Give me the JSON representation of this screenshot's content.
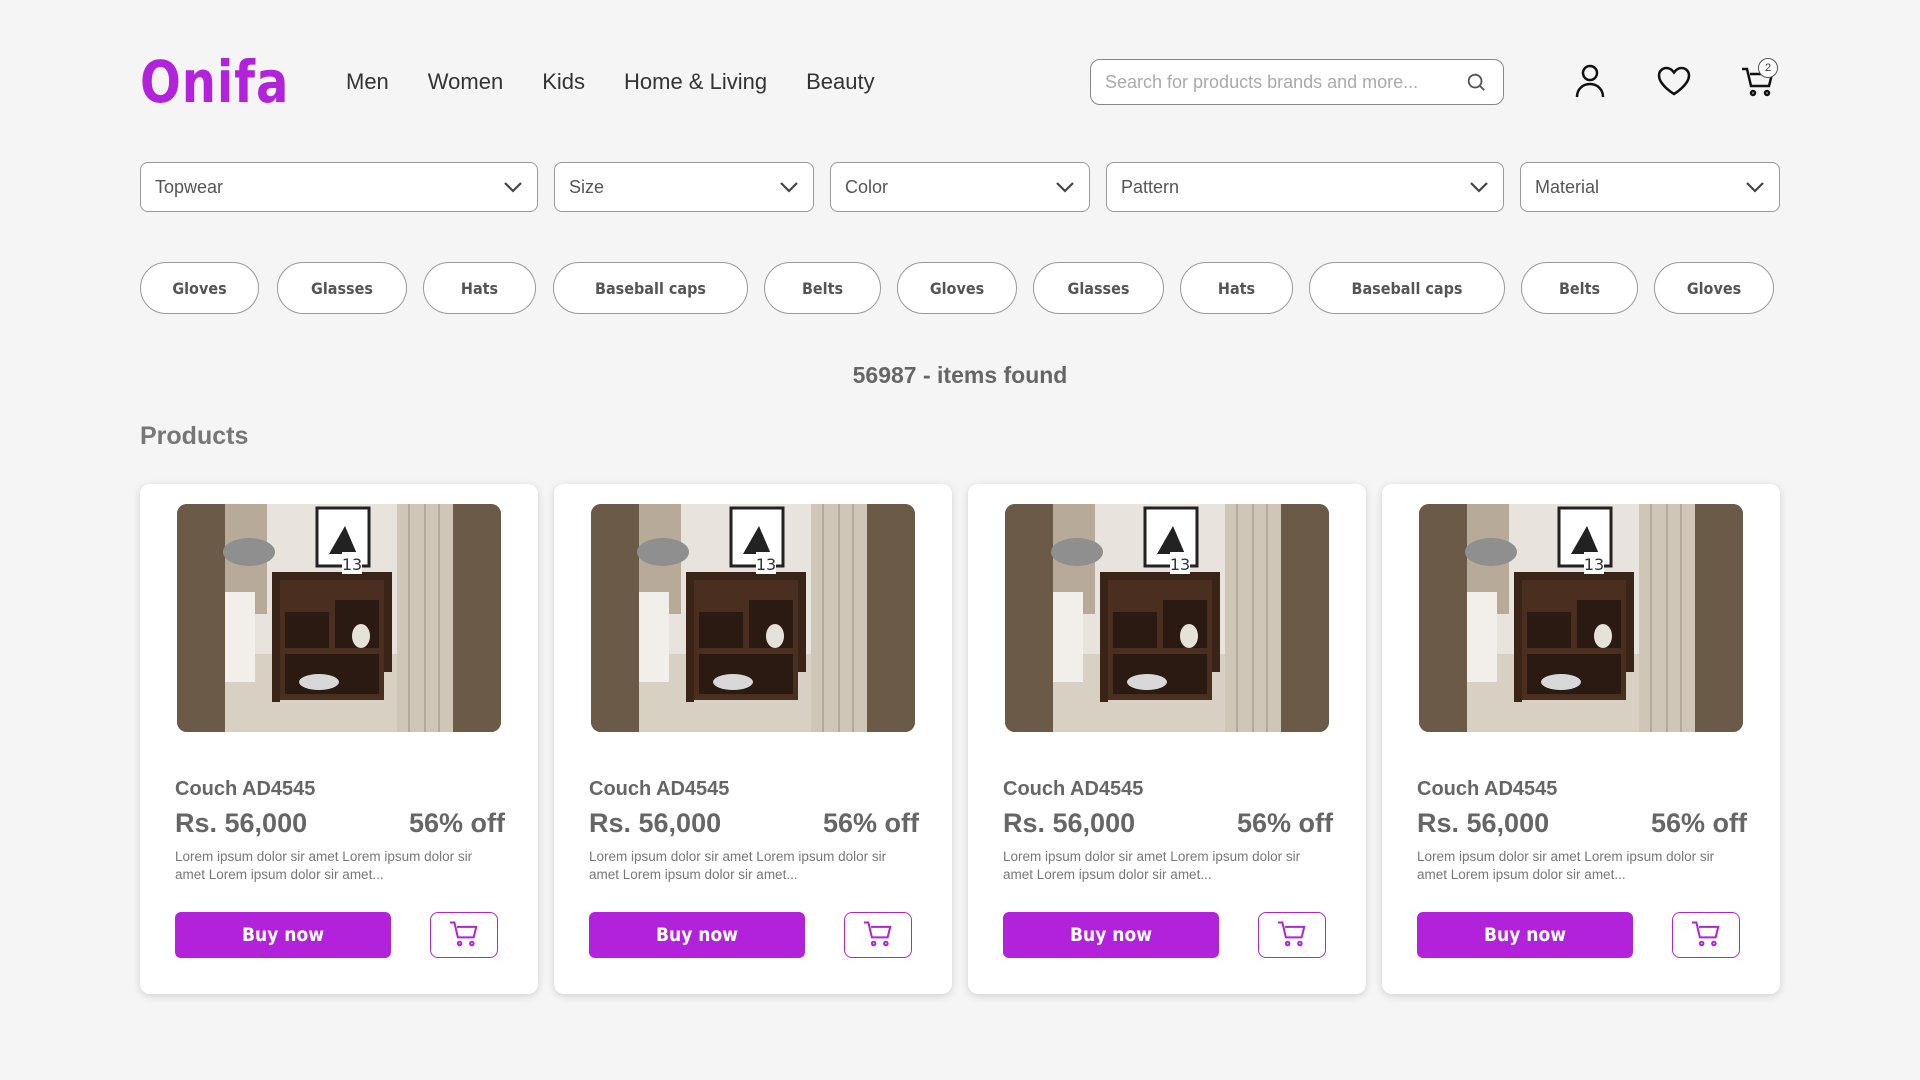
{
  "brand": {
    "logo_text": "Onifa",
    "accent_color": "#b222da"
  },
  "nav": {
    "items": [
      "Men",
      "Women",
      "Kids",
      "Home & Living",
      "Beauty"
    ]
  },
  "search": {
    "placeholder": "Search for products brands and more...",
    "icon": "search-icon"
  },
  "header_icons": {
    "user": "user-icon",
    "wishlist": "heart-icon",
    "cart": "cart-icon",
    "cart_count": "2"
  },
  "filters": [
    "Topwear",
    "Size",
    "Color",
    "Pattern",
    "Material"
  ],
  "chips": [
    "Gloves",
    "Glasses",
    "Hats",
    "Baseball caps",
    "Belts",
    "Gloves",
    "Glasses",
    "Hats",
    "Baseball caps",
    "Belts",
    "Gloves"
  ],
  "results": {
    "count_text": "56987 - items found"
  },
  "section": {
    "title": "Products"
  },
  "products": [
    {
      "name": "Couch AD4545",
      "price": "Rs. 56,000",
      "discount": "56% off",
      "description": "Lorem ipsum dolor sir amet Lorem ipsum dolor sir amet Lorem ipsum dolor sir amet...",
      "buy_label": "Buy now",
      "image_tag": "13"
    },
    {
      "name": "Couch AD4545",
      "price": "Rs. 56,000",
      "discount": "56% off",
      "description": "Lorem ipsum dolor sir amet Lorem ipsum dolor sir amet Lorem ipsum dolor sir amet...",
      "buy_label": "Buy now",
      "image_tag": "13"
    },
    {
      "name": "Couch AD4545",
      "price": "Rs. 56,000",
      "discount": "56% off",
      "description": "Lorem ipsum dolor sir amet Lorem ipsum dolor sir amet Lorem ipsum dolor sir amet...",
      "buy_label": "Buy now",
      "image_tag": "13"
    },
    {
      "name": "Couch AD4545",
      "price": "Rs. 56,000",
      "discount": "56% off",
      "description": "Lorem ipsum dolor sir amet Lorem ipsum dolor sir amet Lorem ipsum dolor sir amet...",
      "buy_label": "Buy now",
      "image_tag": "13"
    }
  ]
}
